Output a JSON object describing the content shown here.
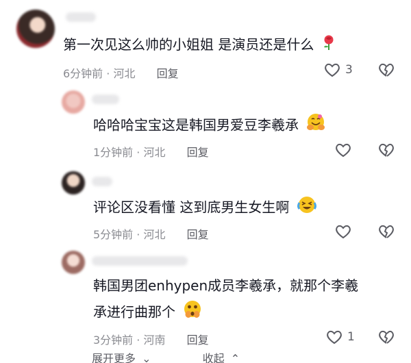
{
  "comments": [
    {
      "text": "第一次见这么帅的小姐姐 是演员还是什么",
      "meta_time": "6分钟前",
      "meta_sep": " · ",
      "meta_loc": "河北",
      "reply_label": "回复",
      "like_count": "3",
      "emoji_icon": "rose-icon"
    },
    {
      "text": "哈哈哈宝宝这是韩国男爱豆李羲承",
      "meta_time": "1分钟前",
      "meta_sep": " · ",
      "meta_loc": "河北",
      "reply_label": "回复",
      "like_count": "",
      "emoji_icon": "hugging-face-icon"
    },
    {
      "text": "评论区没看懂 这到底男生女生啊",
      "meta_time": "5分钟前",
      "meta_sep": " · ",
      "meta_loc": "河北",
      "reply_label": "回复",
      "like_count": "",
      "emoji_icon": "crying-laughing-icon"
    },
    {
      "text_line1": "韩国男团enhypen成员李羲承，就那个李羲",
      "text_line2": "承进行曲那个",
      "meta_time": "3分钟前",
      "meta_sep": " · ",
      "meta_loc": "河南",
      "reply_label": "回复",
      "like_count": "1",
      "emoji_icon": "shocked-hands-face-icon"
    }
  ],
  "footer": {
    "expand_label": "展开更多",
    "collapse_label": "收起"
  },
  "colors": {
    "text": "#161823",
    "meta": "#8a8b91",
    "rose": "#e8394a",
    "emoji_yellow": "#f7c31f"
  }
}
